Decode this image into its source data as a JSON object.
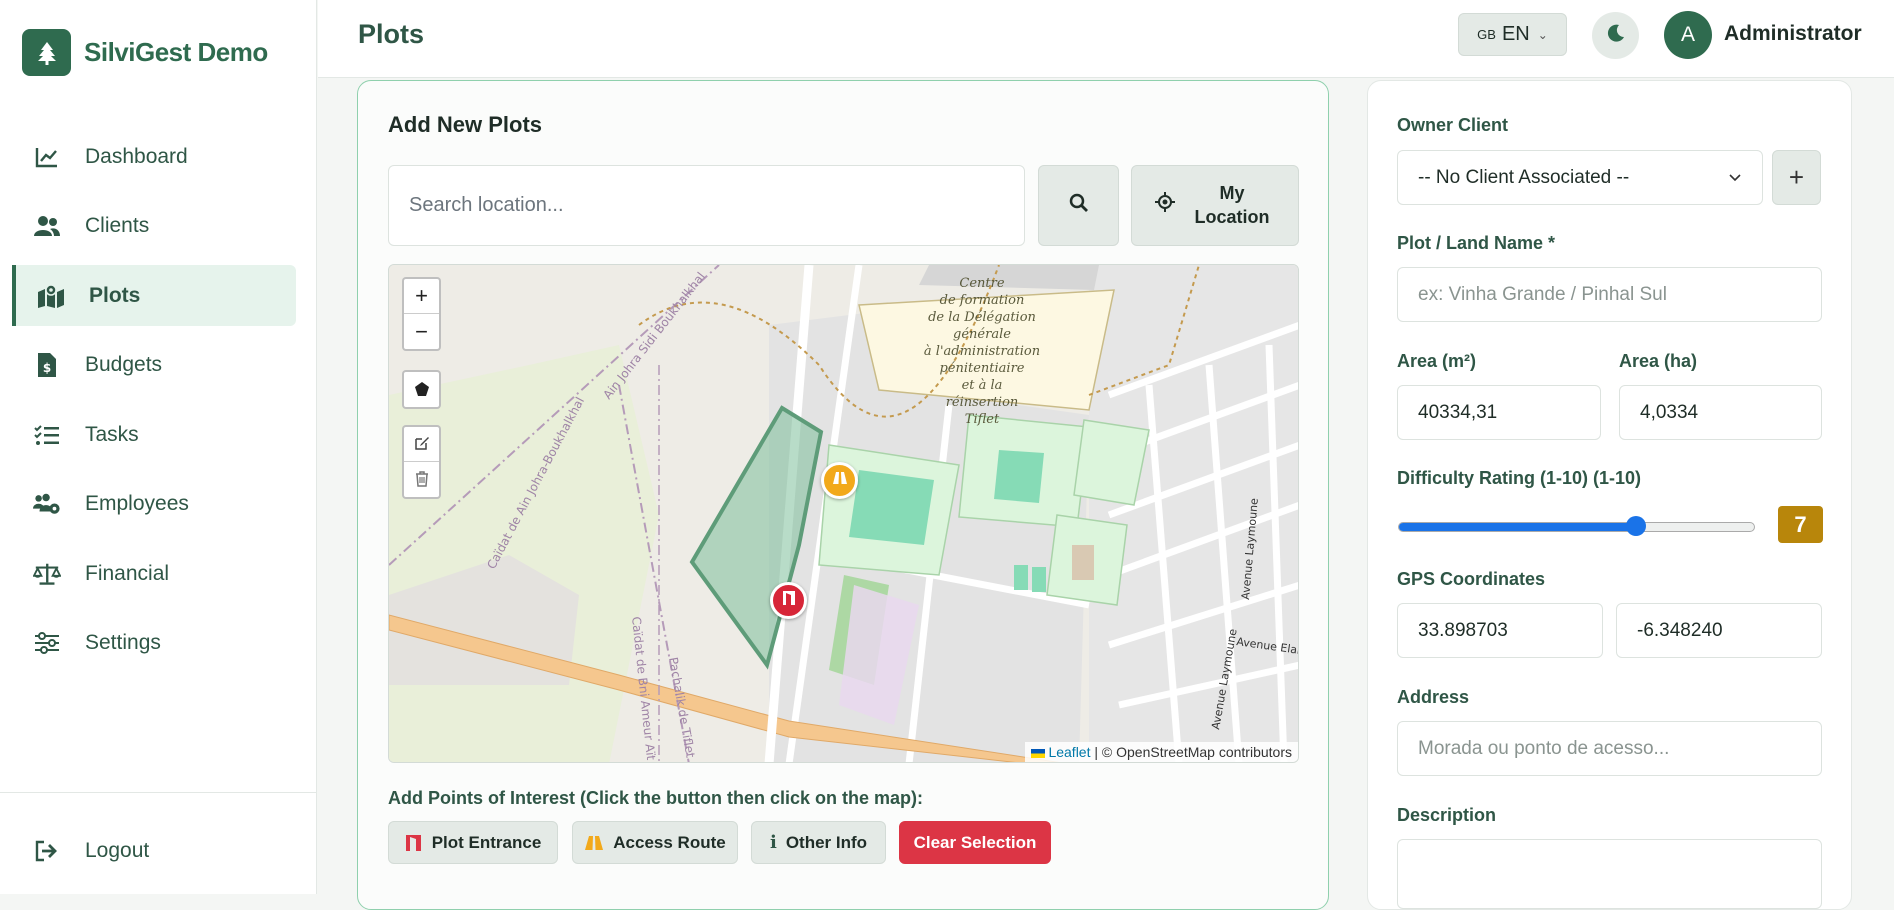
{
  "brand": {
    "name": "SilviGest Demo"
  },
  "sidebar": {
    "items": [
      {
        "label": "Dashboard",
        "icon": "chart-line-icon"
      },
      {
        "label": "Clients",
        "icon": "users-icon"
      },
      {
        "label": "Plots",
        "icon": "map-location-icon",
        "active": true
      },
      {
        "label": "Budgets",
        "icon": "invoice-icon"
      },
      {
        "label": "Tasks",
        "icon": "list-check-icon"
      },
      {
        "label": "Employees",
        "icon": "users-gear-icon"
      },
      {
        "label": "Financial",
        "icon": "scale-icon"
      },
      {
        "label": "Settings",
        "icon": "sliders-icon"
      }
    ],
    "logout": "Logout"
  },
  "header": {
    "title": "Plots",
    "language_flag": "GB",
    "language": "EN",
    "avatar_initial": "A",
    "user_name": "Administrator"
  },
  "form": {
    "title": "Add New Plots",
    "search_placeholder": "Search location...",
    "my_location_label": "My Location",
    "map": {
      "attribution_link": "Leaflet",
      "attribution_text": "| © OpenStreetMap contributors",
      "labels": {
        "building": [
          "Centre",
          "de formation",
          "de la Délégation",
          "générale",
          "à l'administration",
          "pénitentiaire",
          "et à la",
          "réinsertion",
          "Tiflet"
        ],
        "road1": "Ain Johra Sidi Boukhalkhal",
        "road2": "Caïdat de Ain Johra-Boukhalkhal",
        "road3": "Caïdat de Bni Ameur Aït Z",
        "road4": "Pachalik de Tiflet",
        "road5": "Avenue Laymoune",
        "road6": "Avenue Laymoune",
        "road7": "Avenue Elar"
      }
    },
    "poi_label": "Add Points of Interest (Click the button then click on the map):",
    "poi_buttons": {
      "entrance": "Plot Entrance",
      "access": "Access Route",
      "info": "Other Info",
      "clear": "Clear Selection"
    }
  },
  "details": {
    "owner_label": "Owner Client",
    "owner_value": "-- No Client Associated --",
    "plot_name_label": "Plot / Land Name *",
    "plot_name_placeholder": "ex: Vinha Grande / Pinhal Sul",
    "area_m2_label": "Area (m²)",
    "area_m2_value": "40334,31",
    "area_ha_label": "Area (ha)",
    "area_ha_value": "4,0334",
    "difficulty_label": "Difficulty Rating (1-10) (1-10)",
    "difficulty_value": 7,
    "difficulty_value_text": "7",
    "gps_label": "GPS Coordinates",
    "lat": "33.898703",
    "lng": "-6.348240",
    "address_label": "Address",
    "address_placeholder": "Morada ou ponto de acesso...",
    "description_label": "Description"
  },
  "colors": {
    "brand": "#2f6b4f",
    "danger": "#dc3545",
    "rating": "#b8860b",
    "slider": "#1a73e8"
  }
}
